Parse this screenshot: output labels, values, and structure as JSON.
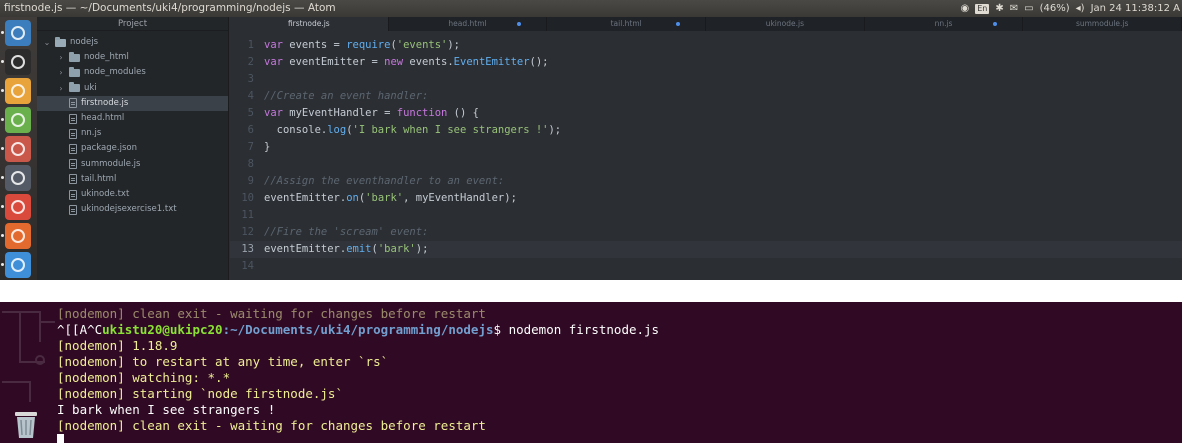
{
  "window_title": "firstnode.js — ~/Documents/uki4/programming/nodejs — Atom",
  "tray": {
    "lang": "En",
    "battery": "(46%)",
    "clock": "Jan 24 11:38:12 A"
  },
  "launcher": [
    "home-folder-icon",
    "terminal-icon",
    "chrome-icon",
    "android-studio-icon",
    "file-manager-icon",
    "settings-icon",
    "ubuntu-software-icon",
    "firefox-icon",
    "cloud-icon"
  ],
  "tree": {
    "header": "Project",
    "items": [
      {
        "label": "nodejs",
        "kind": "folder-open",
        "depth": 0
      },
      {
        "label": "node_html",
        "kind": "folder",
        "depth": 1
      },
      {
        "label": "node_modules",
        "kind": "folder",
        "depth": 1
      },
      {
        "label": "uki",
        "kind": "folder",
        "depth": 1
      },
      {
        "label": "firstnode.js",
        "kind": "file",
        "depth": 1,
        "selected": true
      },
      {
        "label": "head.html",
        "kind": "file",
        "depth": 1
      },
      {
        "label": "nn.js",
        "kind": "file",
        "depth": 1
      },
      {
        "label": "package.json",
        "kind": "file",
        "depth": 1
      },
      {
        "label": "summodule.js",
        "kind": "file",
        "depth": 1
      },
      {
        "label": "tail.html",
        "kind": "file",
        "depth": 1
      },
      {
        "label": "ukinode.txt",
        "kind": "file",
        "depth": 1
      },
      {
        "label": "ukinodejsexercise1.txt",
        "kind": "file",
        "depth": 1
      }
    ]
  },
  "tabs": [
    {
      "label": "firstnode.js",
      "active": true,
      "modified": false
    },
    {
      "label": "head.html",
      "active": false,
      "modified": true
    },
    {
      "label": "tail.html",
      "active": false,
      "modified": true
    },
    {
      "label": "ukinode.js",
      "active": false,
      "modified": false
    },
    {
      "label": "nn.js",
      "active": false,
      "modified": true
    },
    {
      "label": "summodule.js",
      "active": false,
      "modified": false
    }
  ],
  "editor": {
    "current_line": 13,
    "lines": [
      {
        "n": "1",
        "text": "var events = require('events');"
      },
      {
        "n": "2",
        "text": "var eventEmitter = new events.EventEmitter();"
      },
      {
        "n": "3",
        "text": ""
      },
      {
        "n": "4",
        "text": "//Create an event handler:"
      },
      {
        "n": "5",
        "text": "var myEventHandler = function () {"
      },
      {
        "n": "6",
        "text": "  console.log('I bark when I see strangers !');"
      },
      {
        "n": "7",
        "text": "}"
      },
      {
        "n": "8",
        "text": ""
      },
      {
        "n": "9",
        "text": "//Assign the eventhandler to an event:"
      },
      {
        "n": "10",
        "text": "eventEmitter.on('bark', myEventHandler);"
      },
      {
        "n": "11",
        "text": ""
      },
      {
        "n": "12",
        "text": "//Fire the 'scream' event:"
      },
      {
        "n": "13",
        "text": "eventEmitter.emit('bark');"
      },
      {
        "n": "14",
        "text": ""
      }
    ]
  },
  "terminal": {
    "lines": [
      {
        "text": "[nodemon] clean exit - waiting for changes before restart",
        "style": "dim"
      },
      {
        "prefix": "^[[A^C",
        "user": "ukistu20@ukipc20",
        "path": ":~/Documents/uki4/programming/nodejs",
        "cmd": "$ nodemon firstnode.js",
        "style": "prompt"
      },
      {
        "text": "[nodemon] 1.18.9",
        "style": "yellow"
      },
      {
        "text": "[nodemon] to restart at any time, enter `rs`",
        "style": "yellow"
      },
      {
        "text": "[nodemon] watching: *.*",
        "style": "yellow"
      },
      {
        "text": "[nodemon] starting `node firstnode.js`",
        "style": "yellow"
      },
      {
        "text": "I bark when I see strangers !",
        "style": "white"
      },
      {
        "text": "[nodemon] clean exit - waiting for changes before restart",
        "style": "yellow"
      }
    ]
  },
  "colors": {
    "terminal_bg": "#300a24",
    "editor_bg": "#2b2e33",
    "tree_bg": "#232629"
  }
}
